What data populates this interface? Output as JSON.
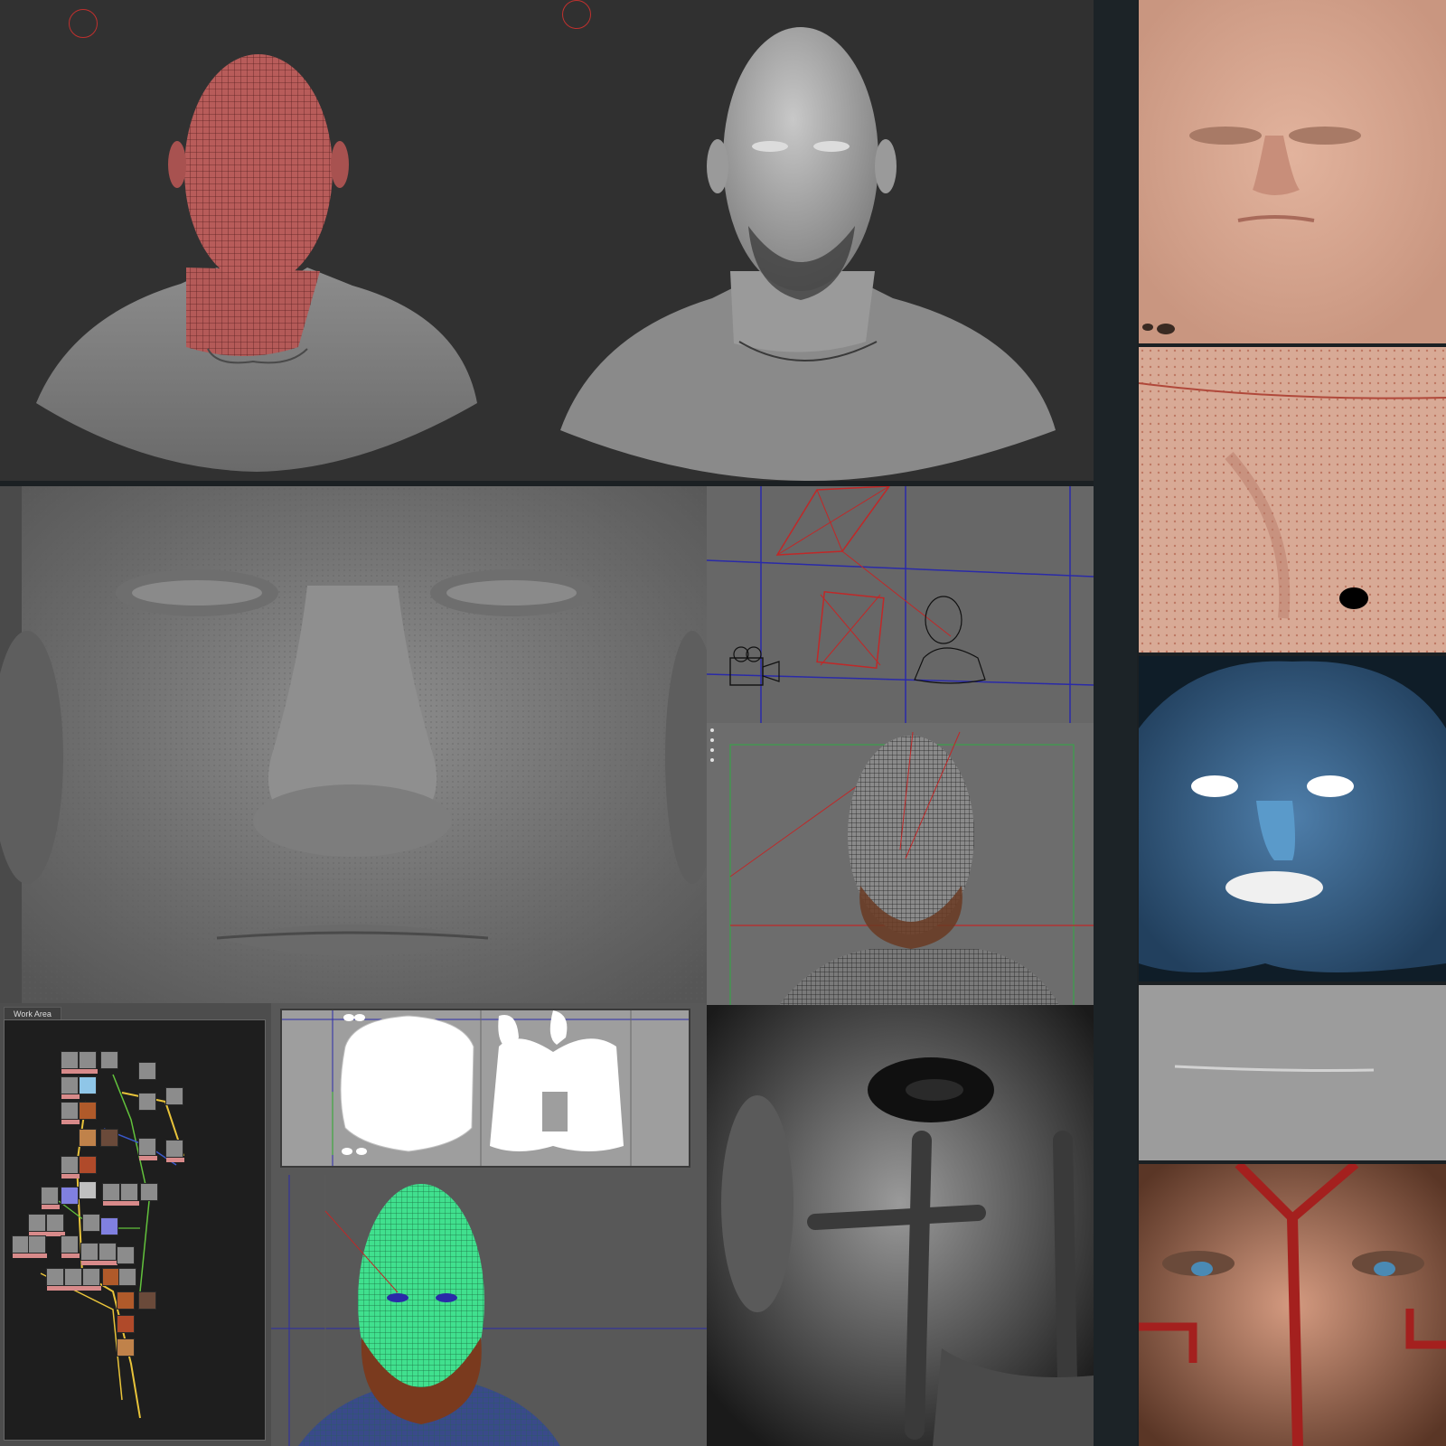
{
  "node_editor": {
    "tab_label": "Work Area"
  },
  "colors": {
    "background": "#1b2023",
    "viewport_dark": "#303030",
    "wire_red": "#b04848",
    "wire_green": "#40e08e",
    "node_link_yellow": "#e8c33a",
    "node_link_green": "#62c23c",
    "node_link_blue": "#3a58c8"
  },
  "icons": {
    "gizmo": "rotate-gizmo-icon",
    "camera": "camera-icon"
  }
}
